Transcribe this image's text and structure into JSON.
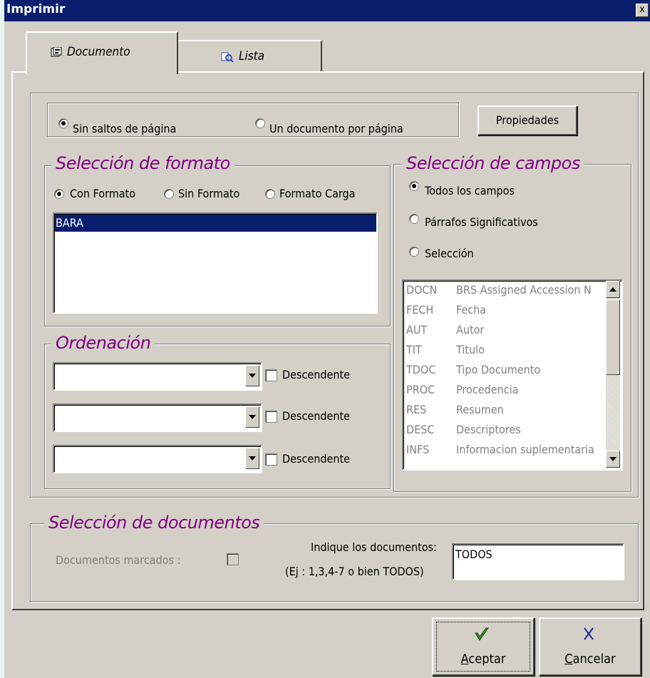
{
  "window": {
    "title": "Imprimir",
    "close_glyph": "x"
  },
  "tabs": [
    {
      "label": "Documento",
      "icon": "document-icon",
      "selected": true
    },
    {
      "label": "Lista",
      "icon": "list-icon",
      "selected": false
    }
  ],
  "page_break": {
    "options": [
      "Sin saltos de página",
      "Un documento por página"
    ],
    "selected": 0,
    "properties_button": "Propiedades"
  },
  "format": {
    "legend": "Selección de formato",
    "options": [
      "Con Formato",
      "Sin Formato",
      "Formato Carga"
    ],
    "selected": 0,
    "list_items": [
      "BARA"
    ],
    "selected_item": "BARA"
  },
  "sort": {
    "legend": "Ordenación",
    "rows": [
      {
        "value": "",
        "descending_label": "Descendente",
        "checked": false
      },
      {
        "value": "",
        "descending_label": "Descendente",
        "checked": false
      },
      {
        "value": "",
        "descending_label": "Descendente",
        "checked": false
      }
    ]
  },
  "fields": {
    "legend": "Selección de campos",
    "options": [
      "Todos los campos",
      "Párrafos Significativos",
      "Selección"
    ],
    "selected": 0,
    "items": [
      {
        "code": "DOCN",
        "name": "BRS Assigned Accession N"
      },
      {
        "code": "FECH",
        "name": "Fecha"
      },
      {
        "code": "AUT",
        "name": "Autor"
      },
      {
        "code": "TIT",
        "name": "Titulo"
      },
      {
        "code": "TDOC",
        "name": "Tipo Documento"
      },
      {
        "code": "PROC",
        "name": "Procedencia"
      },
      {
        "code": "RES",
        "name": "Resumen"
      },
      {
        "code": "DESC",
        "name": "Descriptores"
      },
      {
        "code": "INFS",
        "name": "Informacion suplementaria"
      }
    ]
  },
  "documents": {
    "legend": "Selección de documentos",
    "marked_label": "Documentos marcados :",
    "marked_checked": false,
    "indicate_label": "Indique los documentos:",
    "example_label": "(Ej : 1,3,4-7 o bien TODOS)",
    "input_value": "TODOS"
  },
  "buttons": {
    "accept": {
      "label": "Aceptar",
      "mnemonic": "A",
      "rest": "ceptar",
      "icon": "checkmark-icon",
      "icon_color": "#3a8a1e"
    },
    "cancel": {
      "label": "Cancelar",
      "mnemonic": "C",
      "rest": "ancelar",
      "icon": "x-icon",
      "icon_color": "#1a2a9a"
    }
  },
  "colors": {
    "titlebar": "#0a1e6e",
    "legend": "#800080",
    "selection": "#0a1e6e",
    "background": "#e6f7ef"
  }
}
